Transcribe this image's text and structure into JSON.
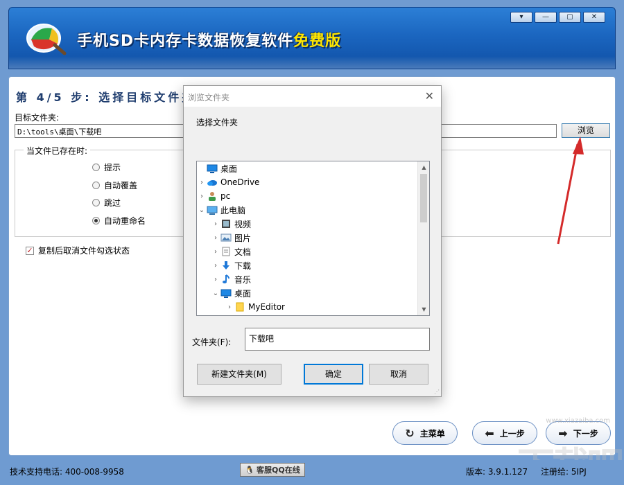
{
  "app": {
    "title_main": "手机SD卡内存卡数据恢复软件",
    "title_free": "免费版",
    "window_buttons": [
      "▾",
      "—",
      "▢",
      "✕"
    ]
  },
  "step": {
    "title": "第 4/5 步: 选择目标文件夹",
    "target_label": "目标文件夹:",
    "target_path": "D:\\tools\\桌面\\下载吧",
    "browse_label": "浏览"
  },
  "exist_group": {
    "legend": "当文件已存在时:",
    "options": [
      {
        "label": "提示",
        "selected": false
      },
      {
        "label": "自动覆盖",
        "selected": false
      },
      {
        "label": "跳过",
        "selected": false
      },
      {
        "label": "自动重命名",
        "selected": true
      }
    ]
  },
  "uncheck_option": {
    "label": "复制后取消文件勾选状态",
    "checked": true
  },
  "nav": {
    "main_menu": "主菜单",
    "prev": "上一步",
    "next": "下一步"
  },
  "status": {
    "support": "技术支持电话: 400-008-9958",
    "qq": "客服QQ在线",
    "version": "版本: 3.9.1.127",
    "registered": "注册给:  5IPJ"
  },
  "watermark": {
    "text": "下载吧",
    "url": "www.xiazaiba.com"
  },
  "dialog": {
    "title": "浏览文件夹",
    "prompt": "选择文件夹",
    "tree": [
      {
        "label": "桌面",
        "icon": "desktop-icon",
        "indent": 0,
        "chevron": ""
      },
      {
        "label": "OneDrive",
        "icon": "cloud-icon",
        "indent": 1,
        "chevron": ">"
      },
      {
        "label": "pc",
        "icon": "user-icon",
        "indent": 1,
        "chevron": ">"
      },
      {
        "label": "此电脑",
        "icon": "computer-icon",
        "indent": 1,
        "chevron": "v"
      },
      {
        "label": "视频",
        "icon": "video-icon",
        "indent": 2,
        "chevron": ">"
      },
      {
        "label": "图片",
        "icon": "picture-icon",
        "indent": 2,
        "chevron": ">"
      },
      {
        "label": "文档",
        "icon": "document-icon",
        "indent": 2,
        "chevron": ">"
      },
      {
        "label": "下载",
        "icon": "download-icon",
        "indent": 2,
        "chevron": ">"
      },
      {
        "label": "音乐",
        "icon": "music-icon",
        "indent": 2,
        "chevron": ">"
      },
      {
        "label": "桌面",
        "icon": "desktop-icon",
        "indent": 2,
        "chevron": "v"
      },
      {
        "label": "MyEditor",
        "icon": "folder-icon",
        "indent": 3,
        "chevron": ">"
      }
    ],
    "folder_label": "文件夹(F):",
    "folder_value": "下载吧",
    "new_folder": "新建文件夹(M)",
    "ok": "确定",
    "cancel": "取消"
  },
  "colors": {
    "accent_red": "#d42a2a",
    "title_blue": "#1b66c0",
    "dialog_primary": "#0078d7"
  }
}
